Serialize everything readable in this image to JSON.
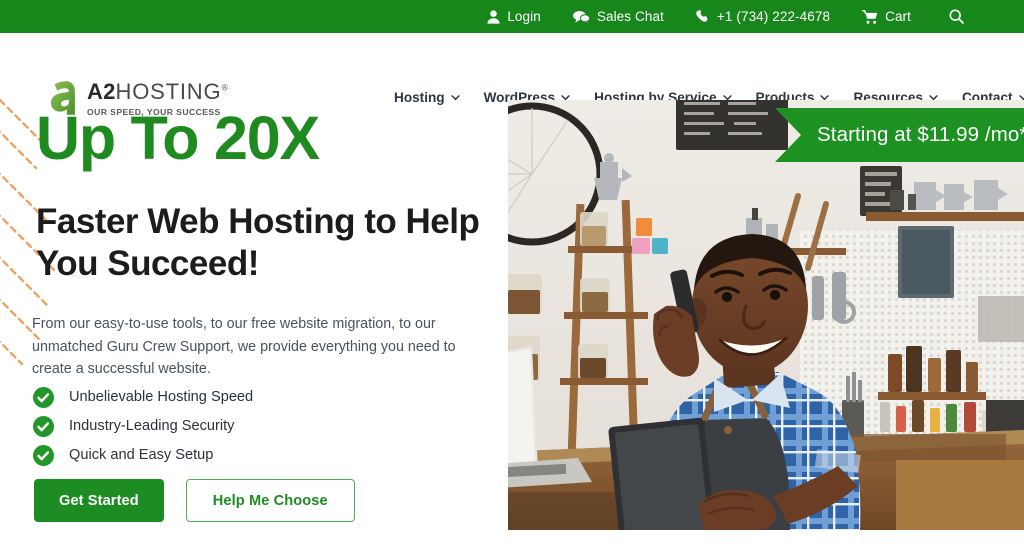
{
  "topbar": {
    "background": "#17871c",
    "items": [
      {
        "label": "Login",
        "icon": "user-icon"
      },
      {
        "label": "Sales Chat",
        "icon": "chat-bubble-icon"
      },
      {
        "label": "+1 (734) 222-4678",
        "icon": "phone-icon"
      },
      {
        "label": "Cart",
        "icon": "shopping-cart-icon"
      },
      {
        "label": "",
        "icon": "search-icon"
      }
    ]
  },
  "header": {
    "logo": {
      "mark": "a2-stylized-a-icon",
      "name_bold": "A2",
      "name_light": "HOSTING",
      "registered": "®",
      "tagline": "OUR SPEED, YOUR SUCCESS"
    },
    "nav": [
      {
        "label": "Hosting",
        "has_dropdown": true
      },
      {
        "label": "WordPress",
        "has_dropdown": true
      },
      {
        "label": "Hosting by Service",
        "has_dropdown": true
      },
      {
        "label": "Products",
        "has_dropdown": true
      },
      {
        "label": "Resources",
        "has_dropdown": true
      },
      {
        "label": "Contact",
        "has_dropdown": true
      }
    ]
  },
  "hero": {
    "headline_top": "Up To 20X",
    "headline_main": "Faster Web Hosting to Help You Succeed!",
    "paragraph": "From our easy-to-use tools, to our free website migration, to our unmatched Guru Crew Support, we provide everything you need to create a successful website.",
    "features": [
      {
        "label": "Unbelievable Hosting Speed",
        "icon": "check-circle-icon"
      },
      {
        "label": "Industry-Leading Security",
        "icon": "check-circle-icon"
      },
      {
        "label": "Quick and Easy Setup",
        "icon": "check-circle-icon"
      }
    ],
    "primary_cta": "Get Started",
    "secondary_cta": "Help Me Choose",
    "price_banner": "Starting at $11.99 /mo*",
    "image_alt": "Smiling barista in blue plaid shirt and apron holding phone and tablet in a coffee shop",
    "accent_green": "#1d8c22",
    "headline_green": "#1f8a1f",
    "deco_orange": "#eda262"
  }
}
